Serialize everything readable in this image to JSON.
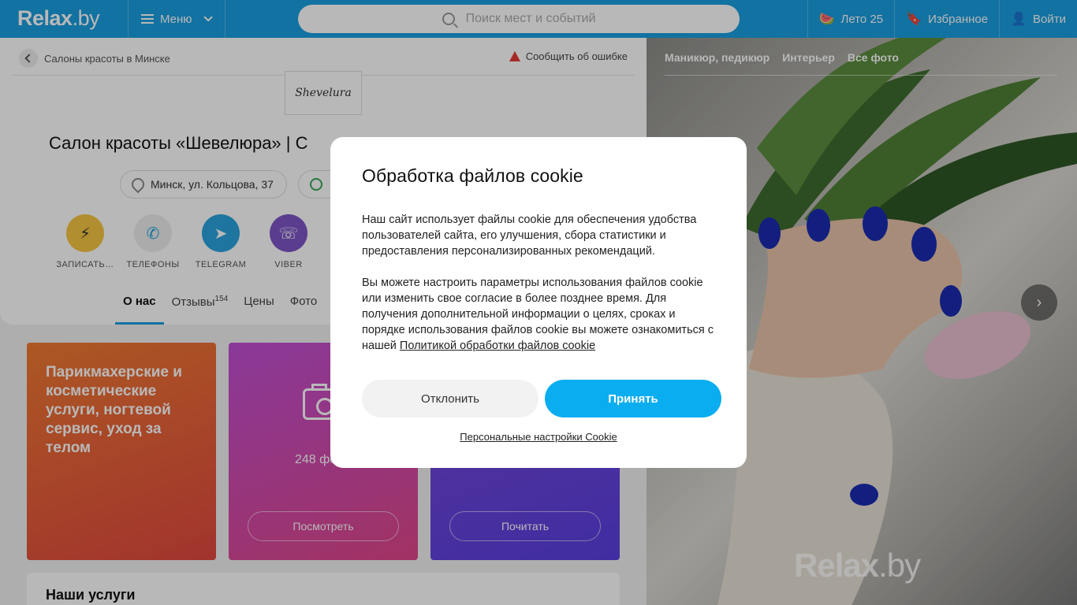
{
  "header": {
    "logo_main": "Relax",
    "logo_suffix": ".by",
    "menu_label": "Меню",
    "search_placeholder": "Поиск мест и событий",
    "summer_label": "Лето 25",
    "favorites_label": "Избранное",
    "login_label": "Войти"
  },
  "breadcrumb": {
    "label": "Салоны красоты в Минске"
  },
  "report_label": "Сообщить об ошибке",
  "salon": {
    "logo_text": "Shevelura",
    "title": "Салон красоты «Шевелюра» | С",
    "address": "Минск, ул. Кольцова, 37"
  },
  "actions": [
    {
      "label": "ЗАПИСАТЬ…",
      "icon": "flash-icon",
      "color": "#f5c542"
    },
    {
      "label": "ТЕЛЕФОНЫ",
      "icon": "phone-icon",
      "color": "#eeeeee"
    },
    {
      "label": "TELEGRAM",
      "icon": "telegram-icon",
      "color": "#2aa3dd"
    },
    {
      "label": "VIBER",
      "icon": "viber-icon",
      "color": "#7d55c7"
    }
  ],
  "tabs": [
    {
      "label": "О нас",
      "active": true
    },
    {
      "label": "Отзывы",
      "count": "154"
    },
    {
      "label": "Цены"
    },
    {
      "label": "Фото"
    }
  ],
  "tiles": {
    "category_text": "Парикмахерские и косметические услуги, ногтевой сервис, уход за телом",
    "photos_count": "248 фо",
    "view_button": "Посмотреть",
    "read_button": "Почитать"
  },
  "services_heading": "Наши услуги",
  "photo": {
    "tabs": [
      "Маникюр, педикюр",
      "Интерьер",
      "Все фото"
    ],
    "watermark_main": "Relax",
    "watermark_suffix": ".by"
  },
  "cookie_modal": {
    "title": "Обработка файлов cookie",
    "para1": "Наш сайт использует файлы cookie для обеспечения удобства пользователей сайта, его улучшения, сбора статистики и предоставления персонализированных рекомендаций.",
    "para2": "Вы можете настроить параметры использования файлов cookie или изменить свое согласие в более позднее время. Для получения дополнительной информации о целях, сроках и порядке использования файлов cookie вы можете ознакомиться с нашей ",
    "policy_link": "Политикой обработки файлов cookie",
    "decline_button": "Отклонить",
    "accept_button": "Принять",
    "settings_link": "Персональные настройки Cookie"
  },
  "colors": {
    "brand": "#1a9ee0",
    "accept": "#0aaef0"
  }
}
